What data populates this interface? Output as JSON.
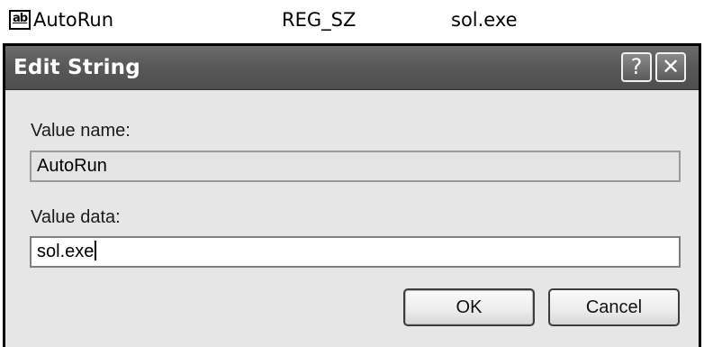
{
  "registry_row": {
    "icon": "string-value-icon",
    "icon_text": "ab",
    "name": "AutoRun",
    "type": "REG_SZ",
    "data": "sol.exe"
  },
  "dialog": {
    "title": "Edit String",
    "help_glyph": "?",
    "close_glyph": "✕",
    "value_name_label": "Value name:",
    "value_name": "AutoRun",
    "value_data_label": "Value data:",
    "value_data": "sol.exe",
    "ok_label": "OK",
    "cancel_label": "Cancel"
  },
  "colors": {
    "titlebar": "#595959",
    "dialog_bg": "#e6e6e6",
    "title_text": "#ffffff"
  }
}
